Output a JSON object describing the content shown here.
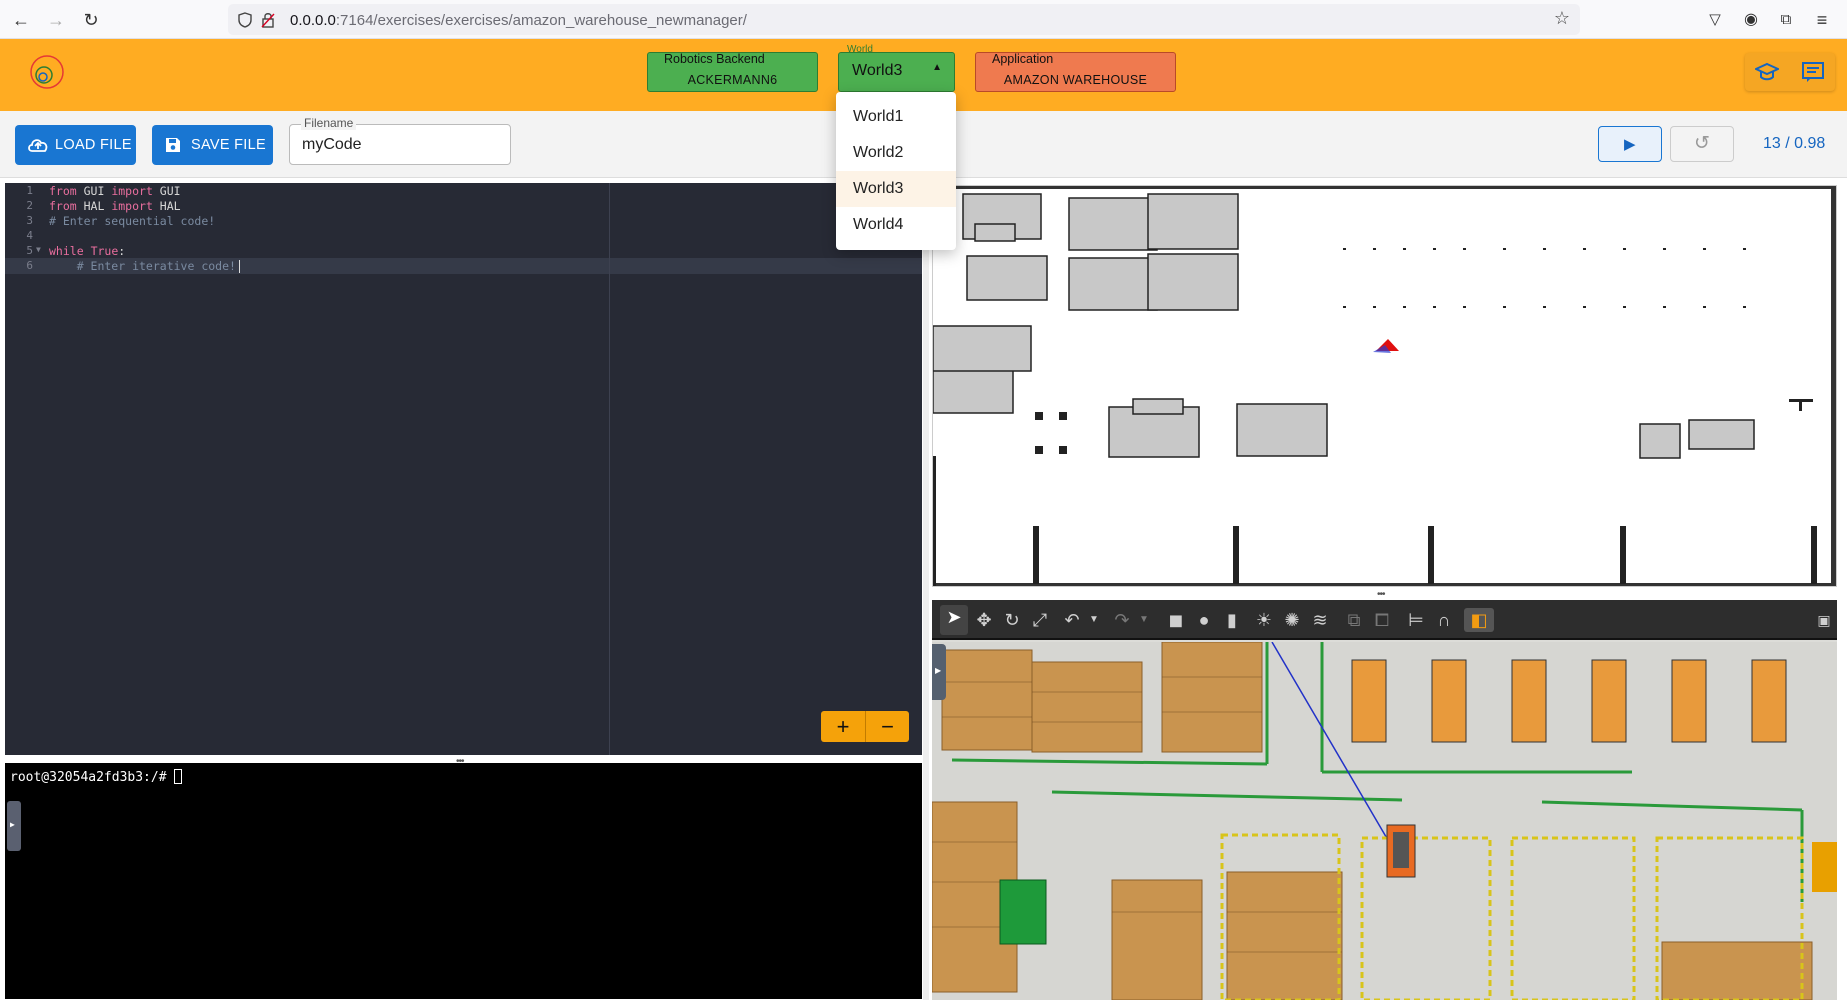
{
  "browser": {
    "url_host": "0.0.0.0",
    "url_path": ":7164/exercises/exercises/amazon_warehouse_newmanager/"
  },
  "header": {
    "backend_caption": "Robotics Backend",
    "backend_value": "ACKERMANN6",
    "world_caption": "World",
    "world_value": "World3",
    "application_caption": "Application",
    "application_value": "AMAZON WAREHOUSE",
    "colors": {
      "bar": "#ffac22",
      "backend": "#4caf50",
      "world": "#4caf50",
      "application": "#ef7a4f"
    }
  },
  "world_menu": {
    "options": [
      "World1",
      "World2",
      "World3",
      "World4"
    ],
    "selected": "World3"
  },
  "toolbar": {
    "load_label": "LOAD FILE",
    "save_label": "SAVE FILE",
    "filename_label": "Filename",
    "filename_value": "myCode",
    "stats": "13 / 0.98"
  },
  "editor": {
    "lines": [
      {
        "n": "1",
        "text": "from GUI import GUI"
      },
      {
        "n": "2",
        "text": "from HAL import HAL"
      },
      {
        "n": "3",
        "text": "# Enter sequential code!"
      },
      {
        "n": "4",
        "text": ""
      },
      {
        "n": "5",
        "text": "while True:"
      },
      {
        "n": "6",
        "text": "    # Enter iterative code!"
      }
    ],
    "zoom_in": "+",
    "zoom_out": "−"
  },
  "terminal": {
    "prompt": "root@32054a2fd3b3:/# "
  }
}
